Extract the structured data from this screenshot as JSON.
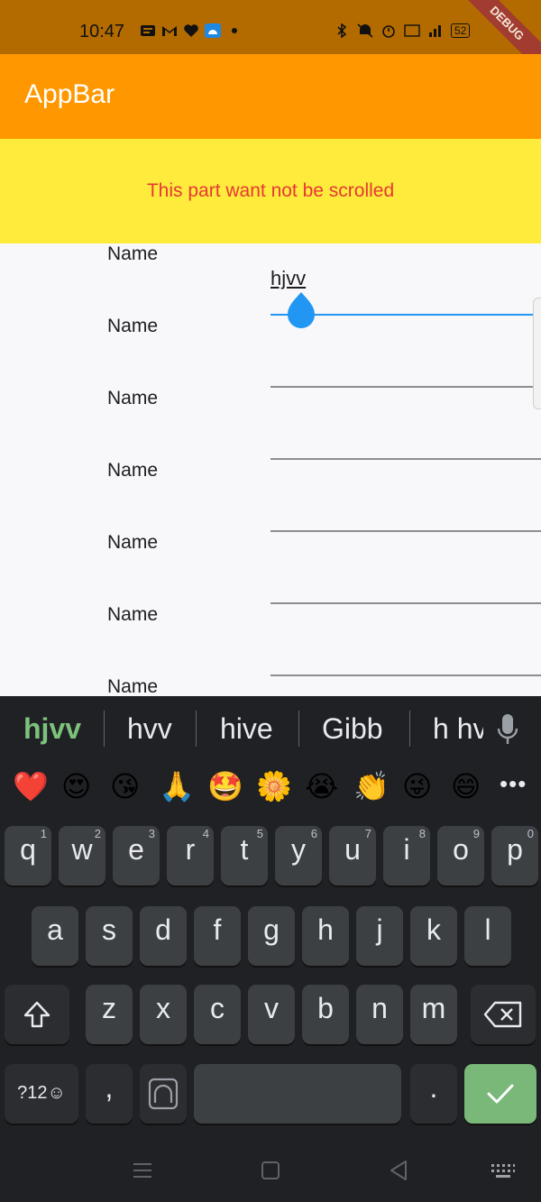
{
  "status_bar": {
    "time": "10:47",
    "battery": "52",
    "debug_label": "DEBUG"
  },
  "app_bar": {
    "title": "AppBar"
  },
  "fixed_header": {
    "text": "This part want not be scrolled"
  },
  "form": {
    "rows": [
      {
        "label": "Name",
        "value": "hjvv"
      },
      {
        "label": "Name",
        "value": ""
      },
      {
        "label": "Name",
        "value": ""
      },
      {
        "label": "Name",
        "value": ""
      },
      {
        "label": "Name",
        "value": ""
      },
      {
        "label": "Name",
        "value": ""
      },
      {
        "label": "Name",
        "value": ""
      }
    ]
  },
  "keyboard": {
    "suggestions": [
      "hjvv",
      "hvv",
      "hive",
      "Gibb",
      "h hv"
    ],
    "emojis": [
      "❤️",
      "😍",
      "😘",
      "🙏",
      "🤩",
      "🌼",
      "😭",
      "👏",
      "😜",
      "😄"
    ],
    "emoji_more": "•••",
    "row1": [
      {
        "ch": "q",
        "num": "1"
      },
      {
        "ch": "w",
        "num": "2"
      },
      {
        "ch": "e",
        "num": "3"
      },
      {
        "ch": "r",
        "num": "4"
      },
      {
        "ch": "t",
        "num": "5"
      },
      {
        "ch": "y",
        "num": "6"
      },
      {
        "ch": "u",
        "num": "7"
      },
      {
        "ch": "i",
        "num": "8"
      },
      {
        "ch": "o",
        "num": "9"
      },
      {
        "ch": "p",
        "num": "0"
      }
    ],
    "row2": [
      "a",
      "s",
      "d",
      "f",
      "g",
      "h",
      "j",
      "k",
      "l"
    ],
    "row3": [
      "z",
      "x",
      "c",
      "v",
      "b",
      "n",
      "m"
    ],
    "symbols_label": "?12☺",
    "comma": ",",
    "period": "."
  },
  "colors": {
    "app_bar": "#ff9800",
    "status_bar": "#b36b00",
    "header_bg": "#ffeb3b",
    "header_text": "#e53935",
    "accent": "#2196f3",
    "keyboard_bg": "#202124",
    "enter_key": "#79b878"
  }
}
